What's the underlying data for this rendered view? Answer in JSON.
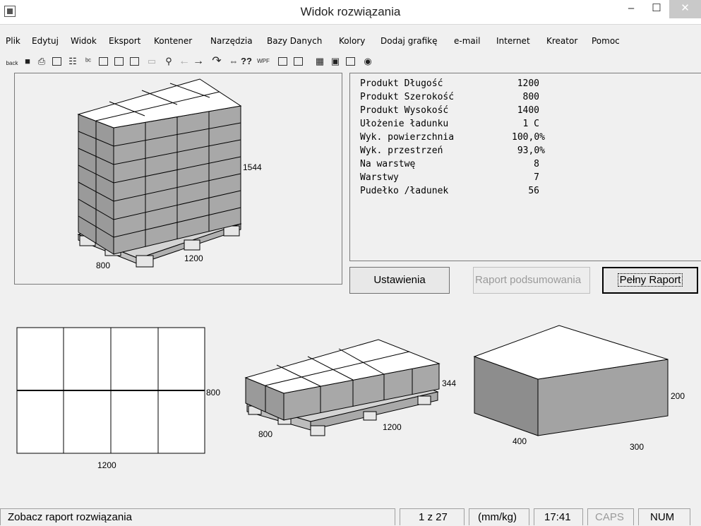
{
  "window": {
    "title": "Widok rozwiązania",
    "min_glyph": "–",
    "max_glyph": "☐",
    "close_glyph": "✕"
  },
  "menu": [
    "Plik",
    "Edytuj",
    "Widok",
    "Eksport",
    "Kontener",
    "Narzędzia",
    "Bazy Danych",
    "Kolory",
    "Dodaj grafikę",
    "e-mail",
    "Internet",
    "Kreator",
    "Pomoc"
  ],
  "toolbar": {
    "back_label": "back",
    "wpf_label": "WPF",
    "question_label": "??",
    "icons": [
      "back-icon",
      "save-icon",
      "print-icon",
      "print-preview-icon",
      "layer-icon",
      "spell-icon",
      "notes-icon",
      "copy-icon",
      "image-icon",
      "comment-icon",
      "zoom-icon",
      "arrow-left-icon",
      "arrow-right-icon",
      "rotate-icon",
      "swap-icon",
      "help-icon",
      "wpf-icon",
      "pdf-icon",
      "report-icon",
      "grid-icon",
      "color-icon",
      "export-icon",
      "settings-icon"
    ]
  },
  "info": {
    "rows": [
      {
        "label": "Produkt Długość",
        "value": "1200"
      },
      {
        "label": "Produkt Szerokość",
        "value": "800"
      },
      {
        "label": "Produkt Wysokość",
        "value": "1400"
      },
      {
        "label": "Ułożenie ładunku",
        "value": "1 C"
      },
      {
        "label": "Wyk. powierzchnia",
        "value": "100,0%"
      },
      {
        "label": "Wyk. przestrzeń",
        "value": "93,0%"
      },
      {
        "label": "Na warstwę",
        "value": "8"
      },
      {
        "label": "Warstwy",
        "value": "7"
      },
      {
        "label": "Pudełko /ładunek",
        "value": "56"
      }
    ]
  },
  "buttons": {
    "settings": "Ustawienia",
    "summary": "Raport podsumowania",
    "full": "Pełny Raport"
  },
  "dims": {
    "pallet_height": "1544",
    "pallet_width": "800",
    "pallet_length": "1200",
    "plan_width": "800",
    "plan_length": "1200",
    "layer_height": "344",
    "layer_width": "800",
    "layer_length": "1200",
    "box_length": "400",
    "box_width": "300",
    "box_height": "200"
  },
  "status": {
    "message": "Zobacz raport rozwiązania",
    "page": "1 z 27",
    "units": "(mm/kg)",
    "time": "17:41",
    "caps": "CAPS",
    "num": "NUM"
  },
  "colors": {
    "box_top": "#ffffff",
    "box_side": "#a3a3a3",
    "box_side_dark": "#8d8d8d",
    "pallet": "#d4d4d4"
  }
}
